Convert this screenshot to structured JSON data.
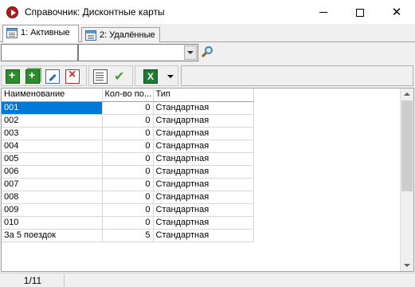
{
  "window": {
    "title": "Справочник: Дисконтные карты",
    "controls": {
      "minimize": "minimize-icon",
      "maximize": "maximize-icon",
      "close": "close-icon"
    }
  },
  "tabs": [
    {
      "label": "1: Активные",
      "active": true
    },
    {
      "label": "2: Удалённые",
      "active": false
    }
  ],
  "filter": {
    "text_value": "",
    "combo_value": ""
  },
  "toolbar": {
    "buttons": [
      "add-icon",
      "copy-icon",
      "edit-icon",
      "delete-icon",
      "properties-icon",
      "check-icon",
      "excel-icon"
    ]
  },
  "table": {
    "columns": [
      "Наименование",
      "Кол-во по...",
      "Тип"
    ],
    "rows": [
      {
        "name": "001",
        "count": "0",
        "type": "Стандартная"
      },
      {
        "name": "002",
        "count": "0",
        "type": "Стандартная"
      },
      {
        "name": "003",
        "count": "0",
        "type": "Стандартная"
      },
      {
        "name": "004",
        "count": "0",
        "type": "Стандартная"
      },
      {
        "name": "005",
        "count": "0",
        "type": "Стандартная"
      },
      {
        "name": "006",
        "count": "0",
        "type": "Стандартная"
      },
      {
        "name": "007",
        "count": "0",
        "type": "Стандартная"
      },
      {
        "name": "008",
        "count": "0",
        "type": "Стандартная"
      },
      {
        "name": "009",
        "count": "0",
        "type": "Стандартная"
      },
      {
        "name": "010",
        "count": "0",
        "type": "Стандартная"
      },
      {
        "name": "За 5 поездок",
        "count": "5",
        "type": "Стандартная"
      }
    ],
    "selected_row": 0
  },
  "status": {
    "position": "1/11"
  },
  "colors": {
    "selection": "#0078d7",
    "window_bg": "#f0f0f0"
  }
}
